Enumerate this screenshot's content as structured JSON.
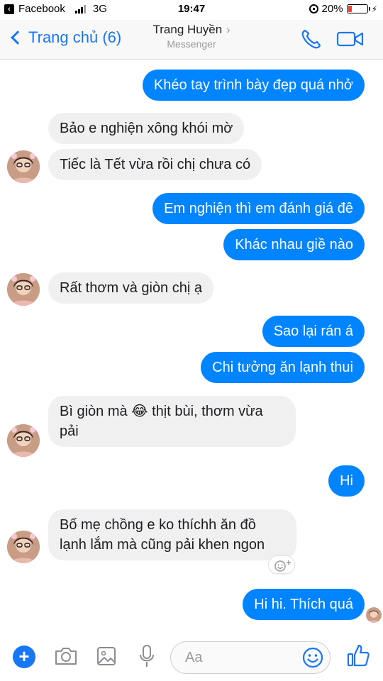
{
  "status_bar": {
    "back_app_label": "Facebook",
    "network": "3G",
    "time": "19:47",
    "battery": "20%",
    "battery_level": 0.2
  },
  "header": {
    "back_label": "Trang chủ (6)",
    "contact_name": "Trang Huyền",
    "subtitle": "Messenger",
    "accent_color": "#1877f2"
  },
  "messages": [
    {
      "side": "out",
      "text": "Khéo tay trình bày đẹp quá nhở"
    },
    {
      "side": "in",
      "text": "Bảo e nghiện xông khói mờ"
    },
    {
      "side": "in",
      "text": "Tiếc là Tết vừa rồi chị chưa có"
    },
    {
      "side": "out",
      "text": "Em nghiện thì em đánh giá đê"
    },
    {
      "side": "out",
      "text": "Khác nhau giề nào"
    },
    {
      "side": "in",
      "text": "Rất thơm và giòn chị ạ"
    },
    {
      "side": "out",
      "text": "Sao lại rán á"
    },
    {
      "side": "out",
      "text": "Chi tưởng ăn lạnh thui"
    },
    {
      "side": "in",
      "text_before": "Bì giòn mà",
      "emoji": "😂",
      "text_after": "thịt bùi, thơm vừa",
      "text_line2": "pải"
    },
    {
      "side": "out",
      "text": "Hi"
    },
    {
      "side": "in",
      "text_line1": "Bố mẹ chồng e ko thíchh ăn đồ",
      "text_line2": "lạnh lắm mà cũng pải khen ngon"
    },
    {
      "side": "out",
      "text": "Hi hi. Thích quá"
    }
  ],
  "composer": {
    "placeholder": "Aa",
    "icons": [
      "plus-icon",
      "camera-icon",
      "image-icon",
      "microphone-icon",
      "emoji-icon",
      "like-icon"
    ]
  },
  "colors": {
    "outgoing_bubble": "#0084ff",
    "incoming_bubble": "#f0f0f0"
  }
}
